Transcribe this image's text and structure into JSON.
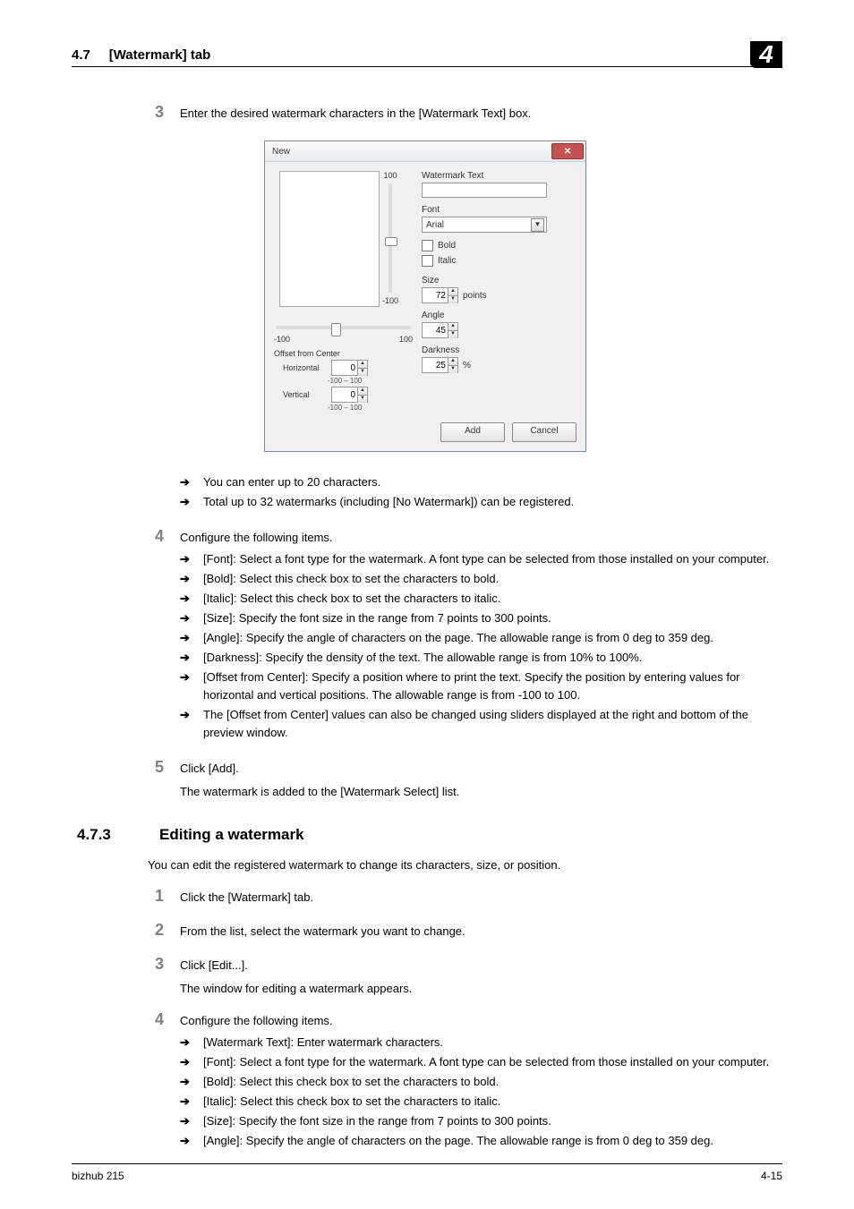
{
  "header": {
    "section_num": "4.7",
    "section_title": "[Watermark] tab",
    "chapter": "4"
  },
  "footer": {
    "left": "bizhub 215",
    "right": "4-15"
  },
  "dialog": {
    "title": "New",
    "vslider_top": "100",
    "vslider_bottom": "-100",
    "hslider_left": "-100",
    "hslider_right": "100",
    "offset_title": "Offset from Center",
    "horizontal_label": "Horizontal",
    "horizontal_value": "0",
    "horizontal_range": "-100 – 100",
    "vertical_label": "Vertical",
    "vertical_value": "0",
    "vertical_range": "-100 – 100",
    "wm_text_label": "Watermark Text",
    "wm_text_value": "",
    "font_label": "Font",
    "font_value": "Arial",
    "bold_label": "Bold",
    "italic_label": "Italic",
    "size_label": "Size",
    "size_value": "72",
    "size_unit": "points",
    "angle_label": "Angle",
    "angle_value": "45",
    "darkness_label": "Darkness",
    "darkness_value": "25",
    "darkness_unit": "%",
    "add_btn": "Add",
    "cancel_btn": "Cancel"
  },
  "step3": {
    "num": "3",
    "text": "Enter the desired watermark characters in the [Watermark Text] box.",
    "bullets": [
      "You can enter up to 20 characters.",
      "Total up to 32 watermarks (including [No Watermark]) can be registered."
    ]
  },
  "step4": {
    "num": "4",
    "text": "Configure the following items.",
    "bullets": [
      "[Font]: Select a font type for the watermark. A font type can be selected from those installed on your computer.",
      "[Bold]: Select this check box to set the characters to bold.",
      "[Italic]: Select this check box to set the characters to italic.",
      "[Size]: Specify the font size in the range from 7 points to 300 points.",
      "[Angle]: Specify the angle of characters on the page. The allowable range is from 0 deg to 359 deg.",
      "[Darkness]: Specify the density of the text. The allowable range is from 10% to 100%.",
      "[Offset from Center]: Specify a position where to print the text. Specify the position by entering values for horizontal and vertical positions. The allowable range is from -100 to 100.",
      "The [Offset from Center] values can also be changed using sliders displayed at the right and bottom of the preview window."
    ]
  },
  "step5": {
    "num": "5",
    "text": "Click [Add].",
    "after": "The watermark is added to the [Watermark Select] list."
  },
  "section": {
    "num": "4.7.3",
    "title": "Editing a watermark",
    "intro": "You can edit the registered watermark to change its characters, size, or position."
  },
  "edit_steps": {
    "s1": {
      "num": "1",
      "text": "Click the [Watermark] tab."
    },
    "s2": {
      "num": "2",
      "text": "From the list, select the watermark you want to change."
    },
    "s3": {
      "num": "3",
      "text": "Click [Edit...].",
      "after": "The window for editing a watermark appears."
    },
    "s4": {
      "num": "4",
      "text": "Configure the following items.",
      "bullets": [
        "[Watermark Text]: Enter watermark characters.",
        "[Font]: Select a font type for the watermark. A font type can be selected from those installed on your computer.",
        "[Bold]:  Select this check box to set the characters to bold.",
        "[Italic]: Select this check box to set the characters to italic.",
        "[Size]: Specify the font size in the range from 7 points to 300 points.",
        "[Angle]: Specify the angle of characters on the page. The allowable range is from 0 deg to 359 deg."
      ]
    }
  }
}
